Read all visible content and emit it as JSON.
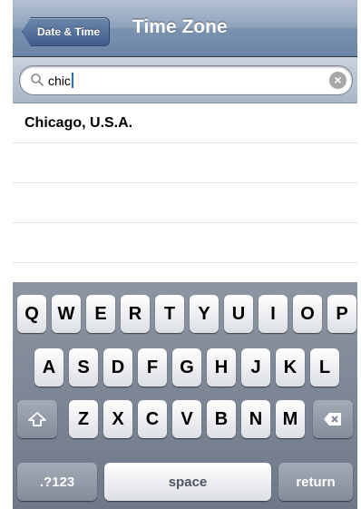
{
  "navbar": {
    "back_label": "Date & Time",
    "title": "Time Zone"
  },
  "search": {
    "query": "chic"
  },
  "results": [
    "Chicago, U.S.A."
  ],
  "keyboard": {
    "row1": [
      "Q",
      "W",
      "E",
      "R",
      "T",
      "Y",
      "U",
      "I",
      "O",
      "P"
    ],
    "row2": [
      "A",
      "S",
      "D",
      "F",
      "G",
      "H",
      "J",
      "K",
      "L"
    ],
    "row3": [
      "Z",
      "X",
      "C",
      "V",
      "B",
      "N",
      "M"
    ],
    "numbers_label": ".?123",
    "space_label": "space",
    "return_label": "return"
  }
}
